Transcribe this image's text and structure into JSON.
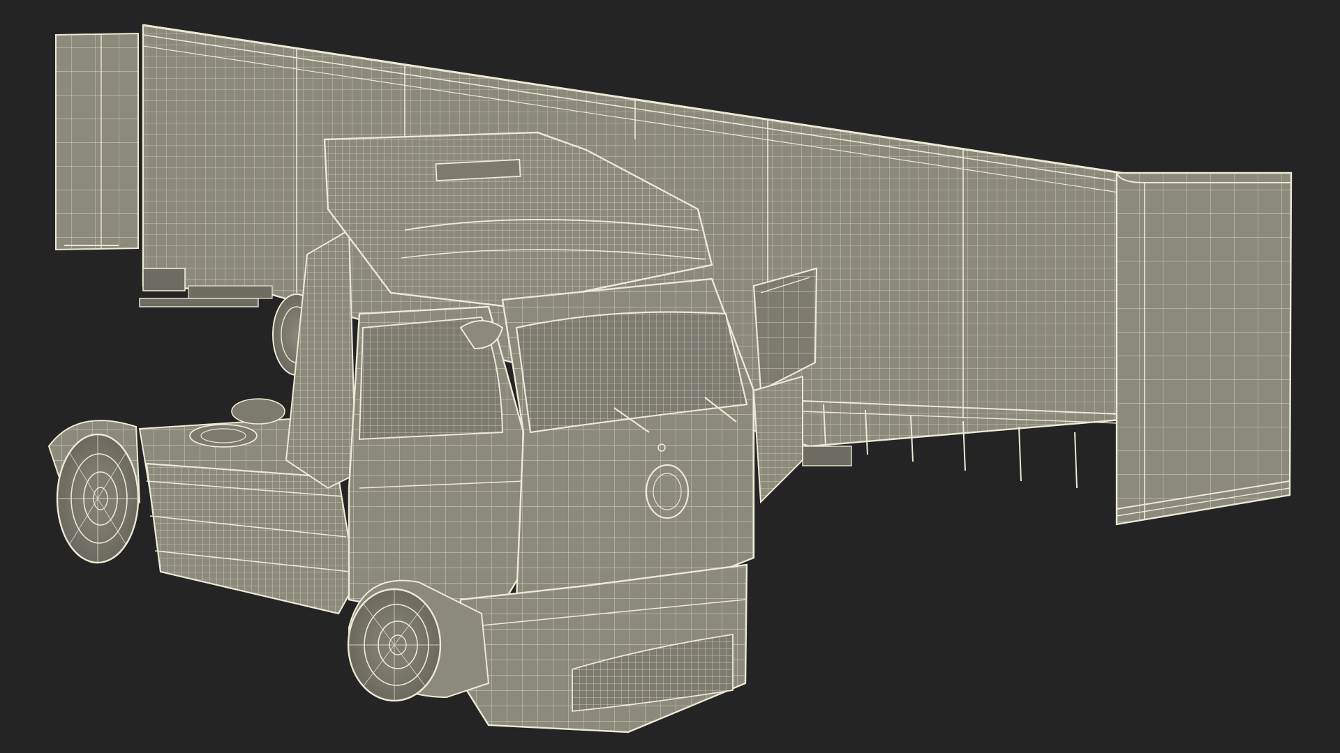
{
  "scene": {
    "background_color": "#242424",
    "mesh_fill_color": "#8c8a7b",
    "mesh_fill_dark_color": "#6f6d61",
    "wire_color": "#ece9d6",
    "wire_dim_color": "#cfcbb4"
  }
}
